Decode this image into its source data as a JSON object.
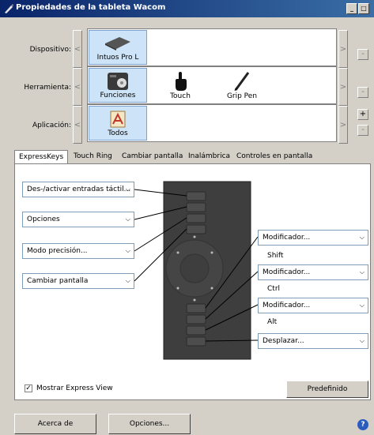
{
  "window": {
    "title": "Propiedades de la tableta Wacom",
    "min_glyph": "_",
    "max_glyph": "□"
  },
  "rows": {
    "device": {
      "label": "Dispositivo:",
      "tiles": [
        {
          "label": "Intuos Pro L",
          "selected": true,
          "icon": "tablet-icon"
        }
      ]
    },
    "tool": {
      "label": "Herramienta:",
      "tiles": [
        {
          "label": "Funciones",
          "selected": true,
          "icon": "functions-icon"
        },
        {
          "label": "Touch",
          "selected": false,
          "icon": "touch-hand-icon"
        },
        {
          "label": "Grip Pen",
          "selected": false,
          "icon": "pen-icon"
        }
      ]
    },
    "app": {
      "label": "Aplicación:",
      "tiles": [
        {
          "label": "Todos",
          "selected": true,
          "icon": "all-apps-icon"
        }
      ]
    }
  },
  "nav": {
    "left": "<",
    "right": ">",
    "minus": "-",
    "plus": "+"
  },
  "tabs": [
    "ExpressKeys",
    "Touch Ring",
    "Cambiar pantalla",
    "Inalámbrica",
    "Controles en pantalla"
  ],
  "active_tab": "ExpressKeys",
  "left_dropdowns": [
    "Des-/activar entradas táctil...",
    "Opciones",
    "Modo precisión...",
    "Cambiar pantalla"
  ],
  "right_dropdowns": [
    {
      "value": "Modificador...",
      "sub": "Shift"
    },
    {
      "value": "Modificador...",
      "sub": "Ctrl"
    },
    {
      "value": "Modificador...",
      "sub": "Alt"
    },
    {
      "value": "Desplazar...",
      "sub": ""
    }
  ],
  "dropdown_arrow": "⌵",
  "show_express_view": {
    "label": "Mostrar Express View",
    "checked": true,
    "mark": "✓"
  },
  "default_button": "Predefinido",
  "footer": {
    "about": "Acerca de",
    "options": "Opciones...",
    "help_glyph": "?"
  },
  "colors": {
    "title_start": "#0a246a",
    "title_end": "#3a6ea5",
    "selected_tile": "#cde3f7",
    "help": "#2b5cbf"
  }
}
